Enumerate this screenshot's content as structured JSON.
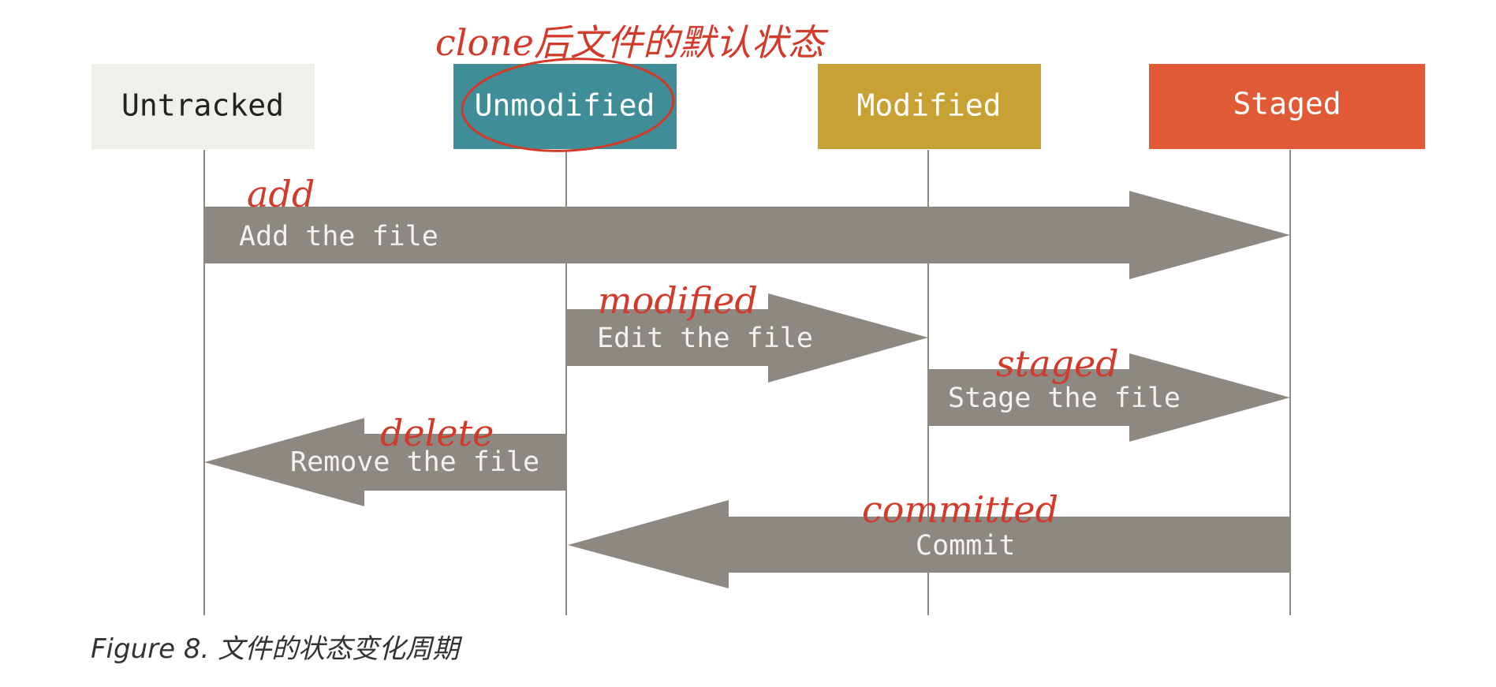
{
  "states": [
    {
      "id": "untracked",
      "label": "Untracked",
      "fill": "#f0efe9",
      "text": "#222222"
    },
    {
      "id": "unmodified",
      "label": "Unmodified",
      "fill": "#3f8d96",
      "text": "#ffffff"
    },
    {
      "id": "modified",
      "label": "Modified",
      "fill": "#c8a135",
      "text": "#ffffff"
    },
    {
      "id": "staged",
      "label": "Staged",
      "fill": "#e05a36",
      "text": "#ffffff"
    }
  ],
  "transitions": [
    {
      "id": "add",
      "label": "Add the file",
      "from": "untracked",
      "to": "staged",
      "note": "add"
    },
    {
      "id": "edit",
      "label": "Edit the file",
      "from": "unmodified",
      "to": "modified",
      "note": "modified"
    },
    {
      "id": "stage",
      "label": "Stage the file",
      "from": "modified",
      "to": "staged",
      "note": "staged"
    },
    {
      "id": "remove",
      "label": "Remove the file",
      "from": "unmodified",
      "to": "untracked",
      "note": "delete"
    },
    {
      "id": "commit",
      "label": "Commit",
      "from": "staged",
      "to": "unmodified",
      "note": "committed"
    }
  ],
  "handwritten_note": "clone后文件的默认状态",
  "colors": {
    "arrow": "#8d8882",
    "lifeline": "#8d8882",
    "ink": "#d23a2a"
  },
  "caption": "Figure 8. 文件的状态变化周期"
}
